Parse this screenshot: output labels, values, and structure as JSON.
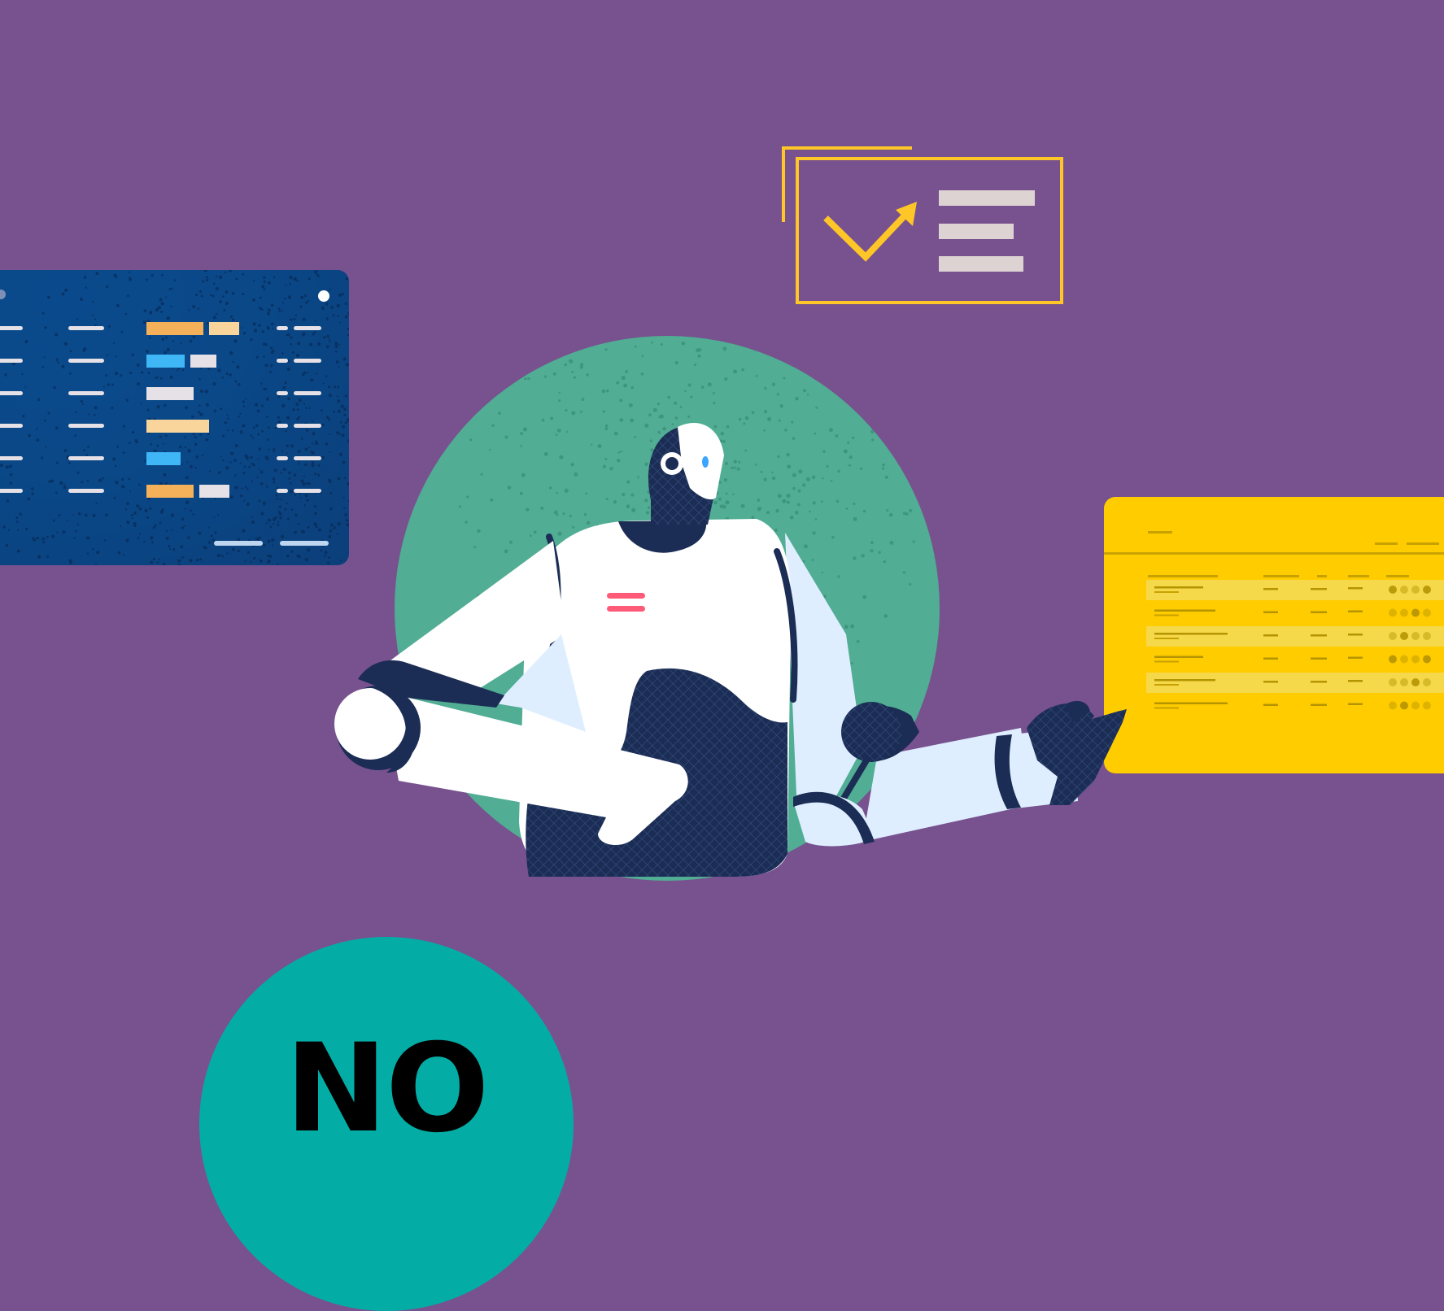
{
  "colors": {
    "background": "#77528e",
    "robot_circle": "#51ad93",
    "blue_panel": "#0a4888",
    "yellow_panel": "#ffcc00",
    "accent_yellow": "#ffc627",
    "badge": "#03ada6",
    "robot_dark": "#1c2d55",
    "robot_white": "#ffffff",
    "chest_mark": "#ff5a78"
  },
  "icons": {
    "blue_panel": "data-table-icon",
    "trend_card": "trend-arrow-icon",
    "yellow_panel": "spreadsheet-icon",
    "figure": "robot-illustration"
  },
  "badge": {
    "text": "NO"
  }
}
